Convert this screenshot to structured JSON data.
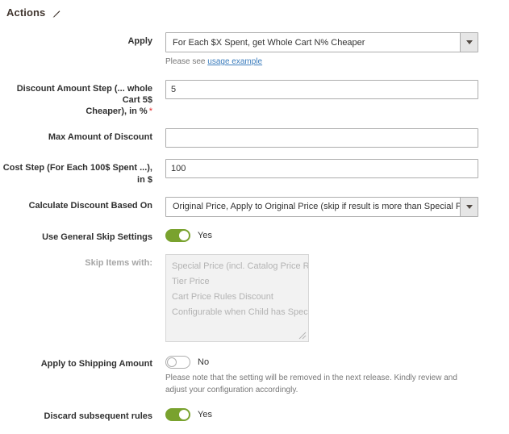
{
  "section": {
    "title": "Actions",
    "edit_icon": "pencil-icon"
  },
  "fields": {
    "apply": {
      "label": "Apply",
      "value": "For Each $X Spent, get Whole Cart N% Cheaper",
      "options": [
        "For Each $X Spent, get Whole Cart N% Cheaper"
      ],
      "note_prefix": "Please see ",
      "note_link": "usage example"
    },
    "discount_amount_step": {
      "label_line1": "Discount Amount Step (... whole Cart 5$",
      "label_line2": "Cheaper), in %",
      "required_marker": "*",
      "value": "5",
      "placeholder": ""
    },
    "max_amount_of_discount": {
      "label": "Max Amount of Discount",
      "value": "",
      "placeholder": ""
    },
    "cost_step": {
      "label": "Cost Step (For Each 100$ Spent ...), in $",
      "value": "100",
      "placeholder": ""
    },
    "calculate_discount_based_on": {
      "label": "Calculate Discount Based On",
      "value": "Original Price, Apply to Original Price (skip if result is more than Special Price)",
      "options": [
        "Original Price, Apply to Original Price (skip if result is more than Special Price)"
      ]
    },
    "use_general_skip_settings": {
      "label": "Use General Skip Settings",
      "state": "Yes",
      "on": true
    },
    "skip_items_with": {
      "label": "Skip Items with:",
      "disabled": true,
      "options": [
        "Special Price (incl. Catalog Price Rules)",
        "Tier Price",
        "Cart Price Rules Discount",
        "Configurable when Child has Special Price"
      ]
    },
    "apply_to_shipping_amount": {
      "label": "Apply to Shipping Amount",
      "state": "No",
      "on": false,
      "note": "Please note that the setting will be removed in the next release. Kindly review and adjust your configuration accordingly."
    },
    "discard_subsequent_rules": {
      "label": "Discard subsequent rules",
      "state": "Yes",
      "on": true
    }
  },
  "colors": {
    "toggle_on": "#79a22e",
    "required": "#e22626",
    "link": "#3c7dbd",
    "label": "#303030"
  }
}
